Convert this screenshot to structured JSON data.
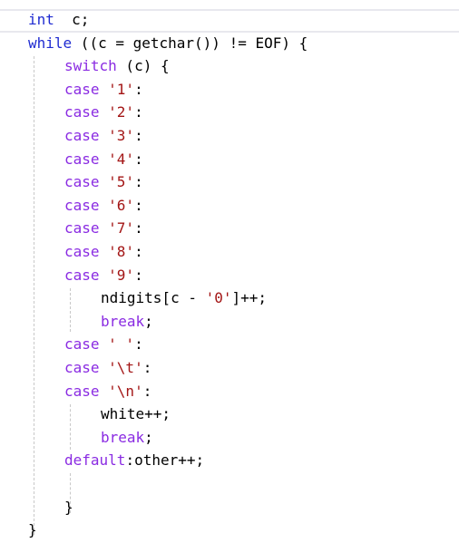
{
  "editor": {
    "lines": [
      {
        "indent": 0,
        "tokens": [
          {
            "t": "int",
            "c": "kw"
          },
          {
            "t": "  c;",
            "c": "plain"
          }
        ]
      },
      {
        "indent": 0,
        "tokens": [
          {
            "t": "while",
            "c": "kw"
          },
          {
            "t": " ((c = getchar()) != EOF) {",
            "c": "plain"
          }
        ]
      },
      {
        "indent": 1,
        "tokens": [
          {
            "t": "switch",
            "c": "kw-purple"
          },
          {
            "t": " (c) {",
            "c": "plain"
          }
        ]
      },
      {
        "indent": 1,
        "tokens": [
          {
            "t": "case",
            "c": "kw-purple"
          },
          {
            "t": " '1'",
            "c": "str"
          },
          {
            "t": ":",
            "c": "plain"
          }
        ]
      },
      {
        "indent": 1,
        "tokens": [
          {
            "t": "case",
            "c": "kw-purple"
          },
          {
            "t": " '2'",
            "c": "str"
          },
          {
            "t": ":",
            "c": "plain"
          }
        ]
      },
      {
        "indent": 1,
        "tokens": [
          {
            "t": "case",
            "c": "kw-purple"
          },
          {
            "t": " '3'",
            "c": "str"
          },
          {
            "t": ":",
            "c": "plain"
          }
        ]
      },
      {
        "indent": 1,
        "tokens": [
          {
            "t": "case",
            "c": "kw-purple"
          },
          {
            "t": " '4'",
            "c": "str"
          },
          {
            "t": ":",
            "c": "plain"
          }
        ]
      },
      {
        "indent": 1,
        "tokens": [
          {
            "t": "case",
            "c": "kw-purple"
          },
          {
            "t": " '5'",
            "c": "str"
          },
          {
            "t": ":",
            "c": "plain"
          }
        ]
      },
      {
        "indent": 1,
        "tokens": [
          {
            "t": "case",
            "c": "kw-purple"
          },
          {
            "t": " '6'",
            "c": "str"
          },
          {
            "t": ":",
            "c": "plain"
          }
        ]
      },
      {
        "indent": 1,
        "tokens": [
          {
            "t": "case",
            "c": "kw-purple"
          },
          {
            "t": " '7'",
            "c": "str"
          },
          {
            "t": ":",
            "c": "plain"
          }
        ]
      },
      {
        "indent": 1,
        "tokens": [
          {
            "t": "case",
            "c": "kw-purple"
          },
          {
            "t": " '8'",
            "c": "str"
          },
          {
            "t": ":",
            "c": "plain"
          }
        ]
      },
      {
        "indent": 1,
        "tokens": [
          {
            "t": "case",
            "c": "kw-purple"
          },
          {
            "t": " '9'",
            "c": "str"
          },
          {
            "t": ":",
            "c": "plain"
          }
        ]
      },
      {
        "indent": 2,
        "tokens": [
          {
            "t": "ndigits[c - ",
            "c": "plain"
          },
          {
            "t": "'0'",
            "c": "str"
          },
          {
            "t": "]++;",
            "c": "plain"
          }
        ]
      },
      {
        "indent": 2,
        "tokens": [
          {
            "t": "break",
            "c": "kw-purple"
          },
          {
            "t": ";",
            "c": "plain"
          }
        ]
      },
      {
        "indent": 1,
        "tokens": [
          {
            "t": "case",
            "c": "kw-purple"
          },
          {
            "t": " ' '",
            "c": "str"
          },
          {
            "t": ":",
            "c": "plain"
          }
        ]
      },
      {
        "indent": 1,
        "tokens": [
          {
            "t": "case",
            "c": "kw-purple"
          },
          {
            "t": " '\\t'",
            "c": "str"
          },
          {
            "t": ":",
            "c": "plain"
          }
        ]
      },
      {
        "indent": 1,
        "tokens": [
          {
            "t": "case",
            "c": "kw-purple"
          },
          {
            "t": " '\\n'",
            "c": "str"
          },
          {
            "t": ":",
            "c": "plain"
          }
        ]
      },
      {
        "indent": 2,
        "tokens": [
          {
            "t": "white++;",
            "c": "plain"
          }
        ]
      },
      {
        "indent": 2,
        "tokens": [
          {
            "t": "break",
            "c": "kw-purple"
          },
          {
            "t": ";",
            "c": "plain"
          }
        ]
      },
      {
        "indent": 1,
        "tokens": [
          {
            "t": "default",
            "c": "kw-purple"
          },
          {
            "t": ":other++;",
            "c": "plain"
          }
        ]
      },
      {
        "indent": 1,
        "tokens": []
      },
      {
        "indent": 1,
        "tokens": [
          {
            "t": "}",
            "c": "plain"
          }
        ]
      },
      {
        "indent": 0,
        "tokens": [
          {
            "t": "}",
            "c": "plain"
          }
        ]
      }
    ]
  },
  "colors": {
    "keyword_blue": "#1f2bd1",
    "keyword_purple": "#8a2be2",
    "string_red": "#a31515",
    "text": "#000000",
    "background": "#ffffff",
    "guide": "#c8c8c8"
  }
}
